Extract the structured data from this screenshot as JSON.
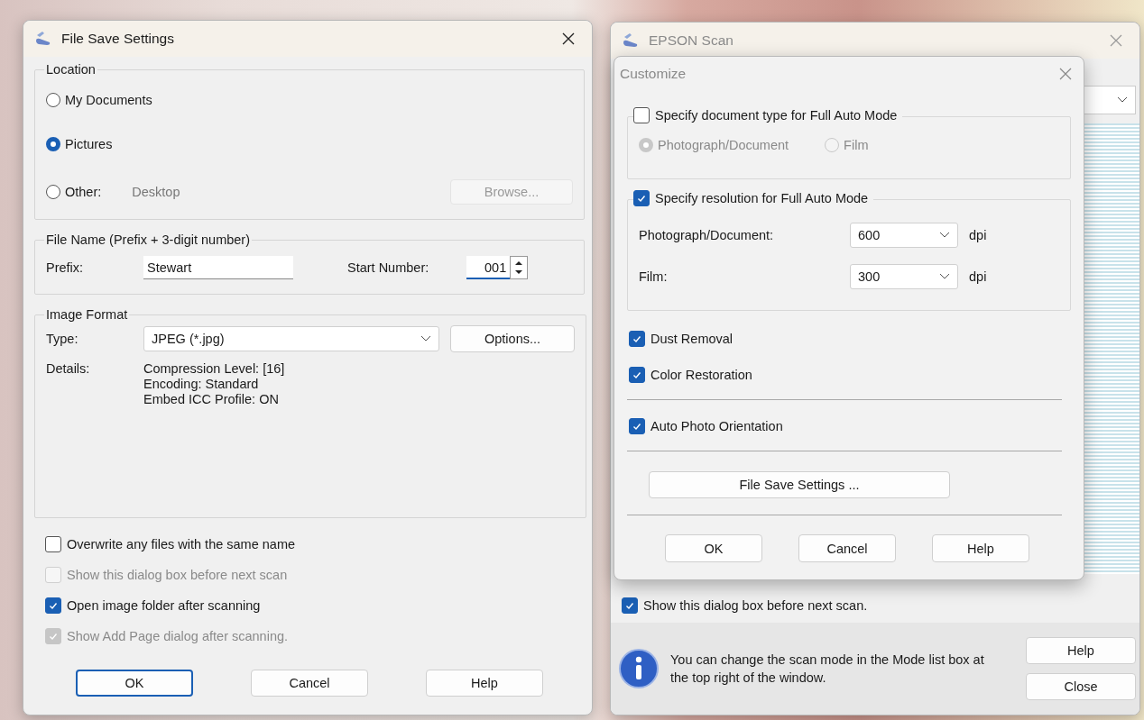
{
  "file_save_dialog": {
    "title": "File Save Settings",
    "location": {
      "label": "Location",
      "options": [
        {
          "label": "My Documents",
          "selected": false
        },
        {
          "label": "Pictures",
          "selected": true
        },
        {
          "label": "Other:",
          "selected": false
        }
      ],
      "other_path": "Desktop",
      "browse_button": {
        "label": "Browse...",
        "disabled": true
      }
    },
    "file_name": {
      "label": "File Name (Prefix + 3-digit number)",
      "prefix_label": "Prefix:",
      "prefix_value": "Stewart",
      "start_label": "Start Number:",
      "start_value": "001"
    },
    "image_format": {
      "label": "Image Format",
      "type_label": "Type:",
      "type_value": "JPEG (*.jpg)",
      "options_button": "Options...",
      "details_label": "Details:",
      "details": [
        "Compression Level: [16]",
        "Encoding: Standard",
        "Embed ICC Profile: ON"
      ]
    },
    "checkboxes": [
      {
        "label": "Overwrite any files with the same name",
        "checked": false,
        "disabled": false
      },
      {
        "label": "Show this dialog box before next scan",
        "checked": false,
        "disabled": true
      },
      {
        "label": "Open image folder after scanning",
        "checked": true,
        "disabled": false
      },
      {
        "label": "Show Add Page dialog after scanning.",
        "checked": true,
        "disabled": true
      }
    ],
    "buttons": [
      {
        "label": "OK",
        "default": true
      },
      {
        "label": "Cancel",
        "default": false
      },
      {
        "label": "Help",
        "default": false
      }
    ]
  },
  "epson_window": {
    "title": "EPSON Scan",
    "show_dialog": {
      "label": "Show this dialog box before next scan.",
      "checked": true
    },
    "info_text": "You can change the scan mode in the Mode list box at the top right of the window.",
    "buttons": [
      "Help",
      "Close"
    ]
  },
  "customize_dialog": {
    "title": "Customize",
    "doc_type": {
      "label": "Specify document type for Full Auto Mode",
      "checked": false,
      "options": [
        {
          "label": "Photograph/Document",
          "selected": true
        },
        {
          "label": "Film",
          "selected": false
        }
      ]
    },
    "resolution": {
      "label": "Specify resolution for Full Auto Mode",
      "checked": true,
      "rows": [
        {
          "label": "Photograph/Document:",
          "value": "600",
          "unit": "dpi"
        },
        {
          "label": "Film:",
          "value": "300",
          "unit": "dpi"
        }
      ]
    },
    "corrections": [
      {
        "label": "Dust Removal",
        "checked": true
      },
      {
        "label": "Color Restoration",
        "checked": true
      }
    ],
    "orientation": {
      "label": "Auto Photo Orientation",
      "checked": true
    },
    "file_save_button": "File Save Settings ...",
    "buttons": [
      "OK",
      "Cancel",
      "Help"
    ]
  }
}
